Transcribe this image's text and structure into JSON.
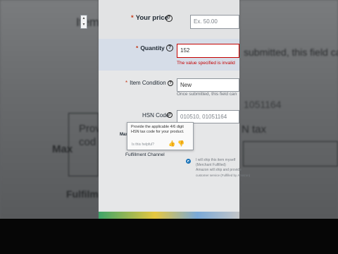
{
  "form": {
    "price": {
      "label": "Your price",
      "placeholder": "Ex. 50.00",
      "help": "?"
    },
    "quantity": {
      "label": "Quantity",
      "value": "152",
      "error": "The value specified is invalid",
      "help": "?"
    },
    "condition": {
      "label": "Item Condition",
      "value": "New",
      "note": "Once submitted, this field can",
      "help": "?"
    },
    "hsn": {
      "label": "HSN Code",
      "placeholder": "010510, 01051164",
      "help": "?"
    },
    "fulfillment": {
      "label": "Fulfillment Channel",
      "option_lines": [
        "I will ship this item myself",
        "(Merchant Fulfilled)",
        "Amazon will ship and provide",
        "customer service (Fulfilled by Amazon)"
      ]
    },
    "required_mark": "*",
    "max_partial": "Max"
  },
  "tooltip": {
    "text": "Provide the applicable 4/6 digit HSN tax code for your product.",
    "feedback": "Is this helpful?"
  },
  "background": {
    "item_fragment": "Item",
    "submitted_fragment": "submitted, this field can",
    "hsn_fragment": "1051164",
    "provide_fragment": "Prov",
    "code_fragment": "cod",
    "tax_fragment": "N tax",
    "max_fragment": "Max",
    "fulfil_fragment": "Fulfilm"
  },
  "colors": {
    "error": "#c40000",
    "accent": "#1a73b8",
    "required": "#c43c1c"
  }
}
